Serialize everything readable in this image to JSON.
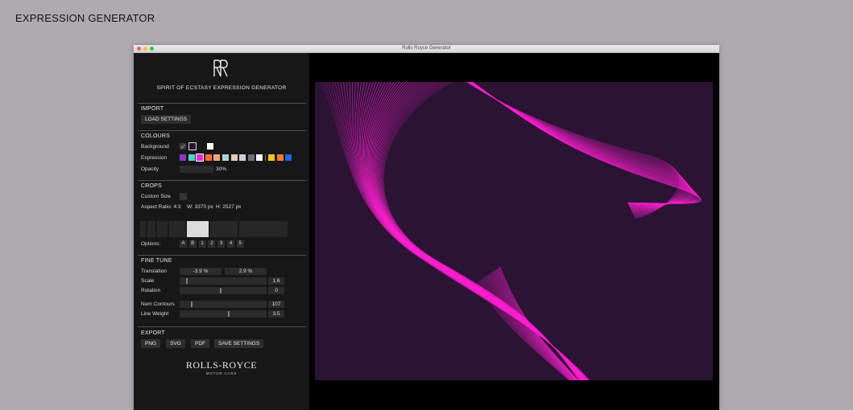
{
  "page_title": "EXPRESSION GENERATOR",
  "window_title": "Rolls Royce Generator",
  "sidebar": {
    "subtitle": "SPIRIT OF ECSTASY EXPRESSION GENERATOR",
    "import": {
      "heading": "IMPORT",
      "load_button": "LOAD SETTINGS"
    },
    "colours": {
      "heading": "COLOURS",
      "background_label": "Background",
      "background_swatches": [
        "#3a3a3a",
        "#2b1238",
        "#ffffff"
      ],
      "expression_label": "Expression",
      "expression_swatches": [
        "#8e35c8",
        "#4fd3c8",
        "#ff1fd1",
        "#ff6b2f",
        "#f4a37e",
        "#a8d4d1",
        "#e8c9b9",
        "#cfcfcf",
        "#6f6f78",
        "#ffffff",
        "#ffc21a",
        "#ff7a1a",
        "#1f62ff"
      ],
      "opacity_label": "Opacity",
      "opacity_value": "30%"
    },
    "crops": {
      "heading": "CROPS",
      "custom_size_label": "Custom Size",
      "aspect_ratio": "Aspect Ratio: 4:3",
      "width": "W: 3370 px",
      "height": "H: 2527 px",
      "options_label": "Options:",
      "options": [
        "A",
        "B",
        "1",
        "2",
        "3",
        "4",
        "5"
      ]
    },
    "fine_tune": {
      "heading": "FINE TUNE",
      "translation_label": "Translation",
      "translation_x": "-3.9 %",
      "translation_y": "2.9 %",
      "scale_label": "Scale",
      "scale_value": "1.6",
      "scale_level": 0.08,
      "rotation_label": "Rotation",
      "rotation_value": "0",
      "rotation_level": 0.47,
      "num_contours_label": "Num Contours",
      "num_contours_value": "107",
      "num_contours_level": 0.13,
      "line_weight_label": "Line Weight",
      "line_weight_value": "3.5",
      "line_weight_level": 0.57
    },
    "export": {
      "heading": "EXPORT",
      "png": "PNG",
      "svg": "SVG",
      "pdf": "PDF",
      "save": "SAVE SETTINGS"
    },
    "brand_logo": "ROLLS-ROYCE",
    "brand_sub": "MOTOR CARS"
  },
  "colors": {
    "artboard_background": "#2a1333",
    "expression": "#ff1fd1"
  }
}
